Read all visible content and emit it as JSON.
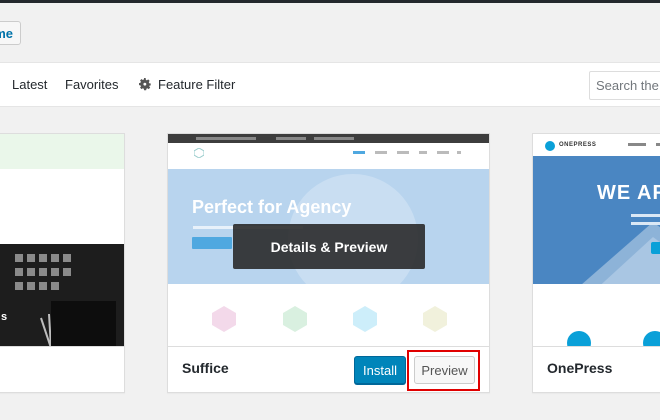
{
  "upload_button": "me",
  "filters": {
    "latest": "Latest",
    "favorites": "Favorites",
    "feature_filter": "Feature Filter",
    "search_placeholder": "Search the"
  },
  "themes": [
    {
      "name": ""
    },
    {
      "name": "Suffice",
      "details_label": "Details & Preview",
      "install_label": "Install",
      "preview_label": "Preview",
      "screenshot": {
        "hero_title": "Perfect for Agency"
      }
    },
    {
      "name": "OnePress",
      "screenshot": {
        "logo_text": "ONEPRESS",
        "hero_title": "WE AR"
      }
    }
  ],
  "colors": {
    "primary_button": "#0085ba",
    "highlight_box": "#e00000",
    "admin_bar": "#23282d"
  }
}
